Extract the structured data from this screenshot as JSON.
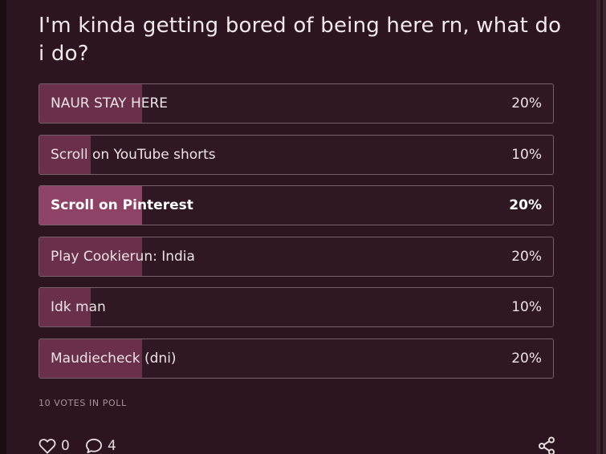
{
  "poll": {
    "question": "I'm kinda getting bored of being here rn, what do i do?",
    "options": [
      {
        "label": "NAUR STAY HERE",
        "percent_text": "20%",
        "fraction": 0.2,
        "selected": false
      },
      {
        "label": "Scroll on YouTube shorts",
        "percent_text": "10%",
        "fraction": 0.1,
        "selected": false
      },
      {
        "label": "Scroll on Pinterest",
        "percent_text": "20%",
        "fraction": 0.2,
        "selected": true
      },
      {
        "label": "Play Cookierun: India",
        "percent_text": "20%",
        "fraction": 0.2,
        "selected": false
      },
      {
        "label": "Idk man",
        "percent_text": "10%",
        "fraction": 0.1,
        "selected": false
      },
      {
        "label": "Maudiecheck (dni)",
        "percent_text": "20%",
        "fraction": 0.2,
        "selected": false
      }
    ],
    "votes_text": "10 VOTES IN POLL"
  },
  "footer": {
    "like_count": "0",
    "reply_count": "4",
    "like_icon": "heart-outline-icon",
    "reply_icon": "speech-bubble-icon",
    "share_icon": "share-icon"
  },
  "colors": {
    "background": "#2c1520",
    "bar_fill": "#6a2f4a",
    "bar_fill_selected": "#8e4266",
    "border": "#76606b",
    "text": "#ede3e7",
    "muted_text": "#a6939c"
  }
}
